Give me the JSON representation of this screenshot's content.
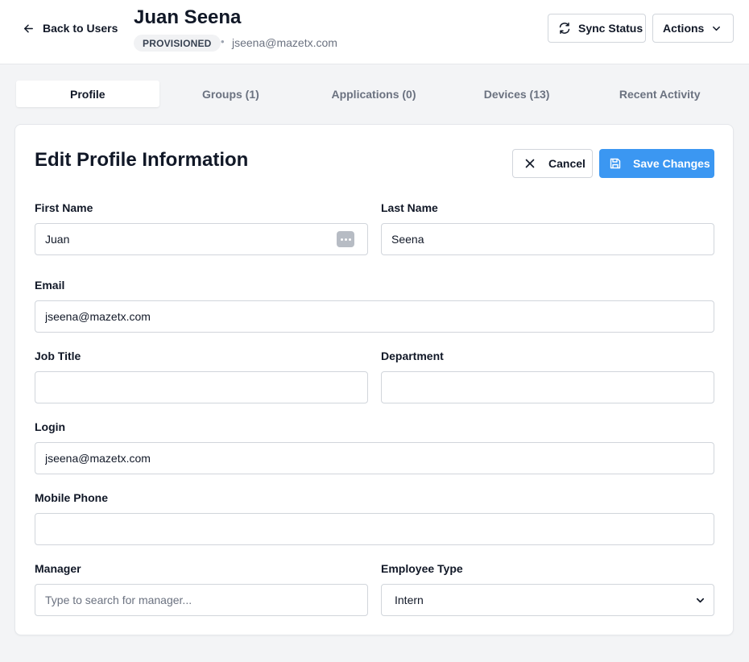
{
  "header": {
    "back_label": "Back to Users",
    "user_name": "Juan Seena",
    "status": "PROVISIONED",
    "separator": "•",
    "email": "jseena@mazetx.com",
    "sync_label": "Sync Status",
    "actions_label": "Actions"
  },
  "tabs": [
    {
      "label": "Profile",
      "active": true
    },
    {
      "label": "Groups (1)",
      "active": false
    },
    {
      "label": "Applications (0)",
      "active": false
    },
    {
      "label": "Devices (13)",
      "active": false
    },
    {
      "label": "Recent Activity",
      "active": false
    }
  ],
  "form": {
    "title": "Edit Profile Information",
    "cancel_label": "Cancel",
    "save_label": "Save Changes",
    "first_name": {
      "label": "First Name",
      "value": "Juan"
    },
    "last_name": {
      "label": "Last Name",
      "value": "Seena"
    },
    "email": {
      "label": "Email",
      "value": "jseena@mazetx.com"
    },
    "job_title": {
      "label": "Job Title",
      "value": ""
    },
    "department": {
      "label": "Department",
      "value": ""
    },
    "login": {
      "label": "Login",
      "value": "jseena@mazetx.com"
    },
    "mobile_phone": {
      "label": "Mobile Phone",
      "value": ""
    },
    "manager": {
      "label": "Manager",
      "value": "",
      "placeholder": "Type to search for manager..."
    },
    "employee_type": {
      "label": "Employee Type",
      "value": "Intern"
    }
  },
  "icons": {
    "back": "arrow-left-icon",
    "sync": "refresh-icon",
    "actions": "chevron-down-icon",
    "cancel": "close-icon",
    "save": "save-icon",
    "password_manager": "password-manager-icon"
  },
  "colors": {
    "primary": "#3b97f2",
    "background": "#f3f4f6",
    "card": "#ffffff",
    "border": "#d1d5db",
    "badge_bg": "#f1f2f4"
  }
}
